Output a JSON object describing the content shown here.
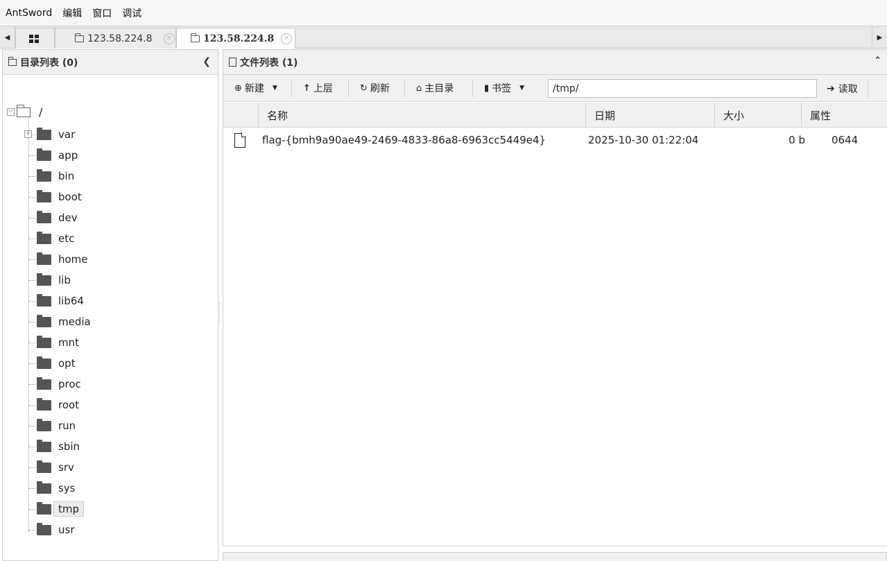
{
  "menu": {
    "items": [
      "AntSword",
      "编辑",
      "窗口",
      "调试"
    ]
  },
  "tabs": [
    {
      "label": "123.58.224.8",
      "active": false
    },
    {
      "label": "123.58.224.8",
      "active": true
    }
  ],
  "left_panel": {
    "title": "目录列表 (0)",
    "root": "/",
    "folders": [
      "var",
      "app",
      "bin",
      "boot",
      "dev",
      "etc",
      "home",
      "lib",
      "lib64",
      "media",
      "mnt",
      "opt",
      "proc",
      "root",
      "run",
      "sbin",
      "srv",
      "sys",
      "tmp",
      "usr"
    ],
    "selected": "tmp",
    "expandable": "var"
  },
  "right_panel": {
    "title": "文件列表 (1)",
    "toolbar": {
      "new_label": "新建",
      "up_label": "上层",
      "refresh_label": "刷新",
      "home_label": "主目录",
      "bookmark_label": "书签",
      "path_value": "/tmp/",
      "read_label": "读取"
    },
    "columns": [
      "名称",
      "日期",
      "大小",
      "属性"
    ],
    "files": [
      {
        "name": "flag-{bmh9a90ae49-2469-4833-86a8-6963cc5449e4}",
        "date": "2025-10-30 01:22:04",
        "size": "0 b",
        "attr": "0644"
      }
    ]
  }
}
